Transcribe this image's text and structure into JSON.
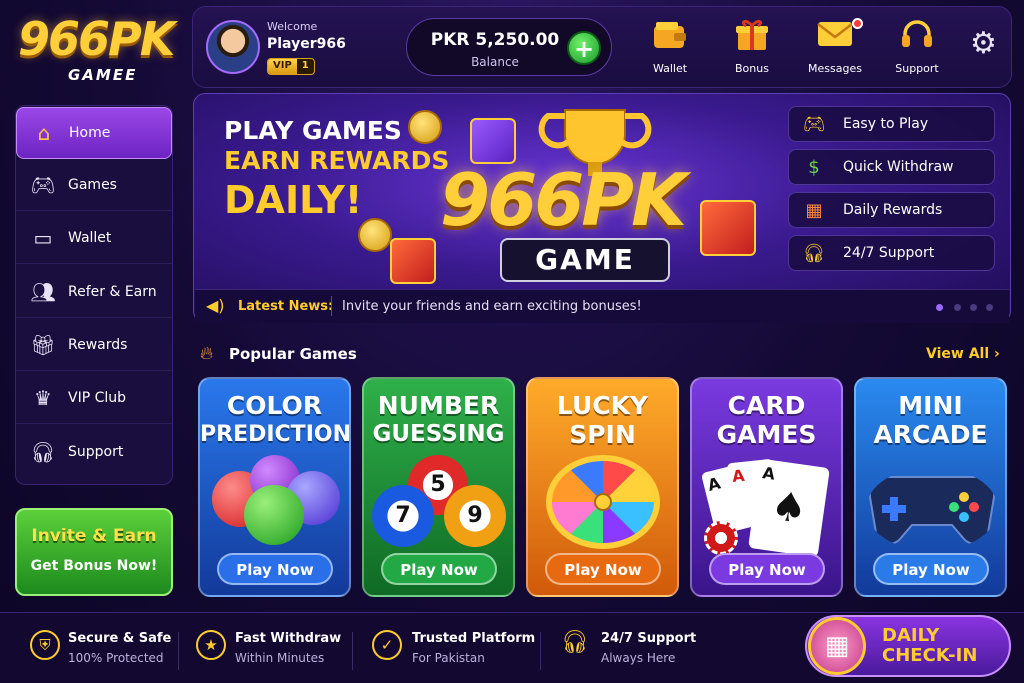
{
  "logo": {
    "main": "966PK",
    "sub": "GAMEE"
  },
  "user": {
    "welcome": "Welcome",
    "name": "Player966",
    "vip_label": "VIP",
    "vip_level": "1"
  },
  "balance": {
    "amount": "PKR 5,250.00",
    "label": "Balance",
    "add_icon": "plus-icon"
  },
  "topnav": [
    {
      "label": "Wallet",
      "icon": "wallet-icon"
    },
    {
      "label": "Bonus",
      "icon": "gift-icon"
    },
    {
      "label": "Messages",
      "icon": "envelope-icon"
    },
    {
      "label": "Support",
      "icon": "headset-icon"
    }
  ],
  "settings_icon": "gear-icon",
  "sidebar": {
    "items": [
      {
        "label": "Home",
        "icon": "home-icon",
        "active": true
      },
      {
        "label": "Games",
        "icon": "gamepad-icon"
      },
      {
        "label": "Wallet",
        "icon": "wallet-icon"
      },
      {
        "label": "Refer & Earn",
        "icon": "users-icon"
      },
      {
        "label": "Rewards",
        "icon": "gift-icon"
      },
      {
        "label": "VIP Club",
        "icon": "crown-icon"
      },
      {
        "label": "Support",
        "icon": "headset-icon"
      }
    ]
  },
  "invite": {
    "title": "Invite & Earn",
    "subtitle": "Get Bonus Now!"
  },
  "banner": {
    "line1": "PLAY GAMES",
    "line2": "EARN REWARDS",
    "line3": "DAILY!",
    "title": "966PK",
    "ribbon": "GAME",
    "features": [
      {
        "label": "Easy to Play",
        "icon": "gamepad-icon"
      },
      {
        "label": "Quick Withdraw",
        "icon": "cash-icon"
      },
      {
        "label": "Daily Rewards",
        "icon": "calendar-icon"
      },
      {
        "label": "24/7 Support",
        "icon": "headset-icon"
      }
    ]
  },
  "news": {
    "label": "Latest News:",
    "text": "Invite your friends and earn exciting bonuses!",
    "icon": "megaphone-icon"
  },
  "popular": {
    "title": "Popular Games",
    "view_all": "View All"
  },
  "games": [
    {
      "title1": "COLOR",
      "title2": "PREDICTION",
      "button": "Play Now",
      "bg": "#1f5fd6",
      "btn": "#2a6ee8"
    },
    {
      "title1": "NUMBER",
      "title2": "GUESSING",
      "button": "Play Now",
      "bg": "#1d9a3a",
      "btn": "#22a845",
      "balls": [
        "5",
        "7",
        "9"
      ]
    },
    {
      "title1": "LUCKY",
      "title2": "SPIN",
      "button": "Play Now",
      "bg": "#f08a12",
      "btn": "#e86a10"
    },
    {
      "title1": "CARD",
      "title2": "GAMES",
      "button": "Play Now",
      "bg": "#6a2ad0",
      "btn": "#7a3ae0"
    },
    {
      "title1": "MINI",
      "title2": "ARCADE",
      "button": "Play Now",
      "bg": "#1e6ad8",
      "btn": "#2a7ae8"
    }
  ],
  "footer": [
    {
      "title": "Secure & Safe",
      "sub": "100% Protected",
      "icon": "shield-icon"
    },
    {
      "title": "Fast Withdraw",
      "sub": "Within Minutes",
      "icon": "star-icon"
    },
    {
      "title": "Trusted Platform",
      "sub": "For Pakistan",
      "icon": "badge-icon"
    },
    {
      "title": "24/7 Support",
      "sub": "Always Here",
      "icon": "headset-icon"
    }
  ],
  "checkin": {
    "line1": "DAILY",
    "line2": "CHECK-IN",
    "icon": "calendar-icon"
  }
}
